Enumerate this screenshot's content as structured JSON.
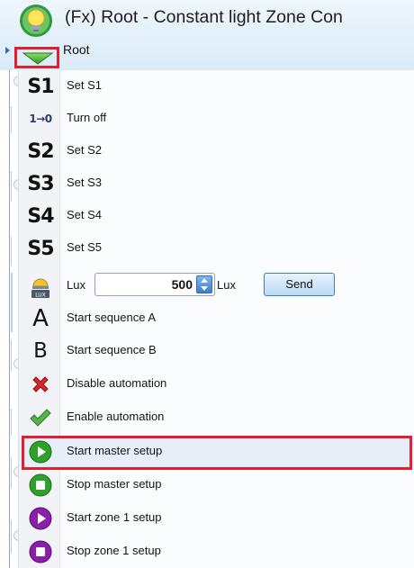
{
  "header": {
    "title": "(Fx) Root - Constant light Zone Con",
    "subtitle": "Root"
  },
  "menu": {
    "items": [
      {
        "label": "Set S1",
        "icon": "S1"
      },
      {
        "label": "Turn off",
        "icon": "1→0"
      },
      {
        "label": "Set S2",
        "icon": "S2"
      },
      {
        "label": "Set S3",
        "icon": "S3"
      },
      {
        "label": "Set S4",
        "icon": "S4"
      },
      {
        "label": "Set S5",
        "icon": "S5"
      },
      {
        "label": "Lux"
      },
      {
        "label": "Start sequence A",
        "icon": "A"
      },
      {
        "label": "Start sequence B",
        "icon": "B"
      },
      {
        "label": "Disable automation"
      },
      {
        "label": "Enable automation"
      },
      {
        "label": "Start master setup"
      },
      {
        "label": "Stop master setup"
      },
      {
        "label": "Start zone 1 setup"
      },
      {
        "label": "Stop zone 1 setup"
      }
    ],
    "lux": {
      "value": "500",
      "unit": "Lux",
      "send_label": "Send",
      "icon_text": "LUX"
    }
  },
  "colors": {
    "highlight_border": "#e02030",
    "green": "#2fa02a",
    "purple": "#8a1fa8",
    "disable_red": "#d9262c"
  }
}
